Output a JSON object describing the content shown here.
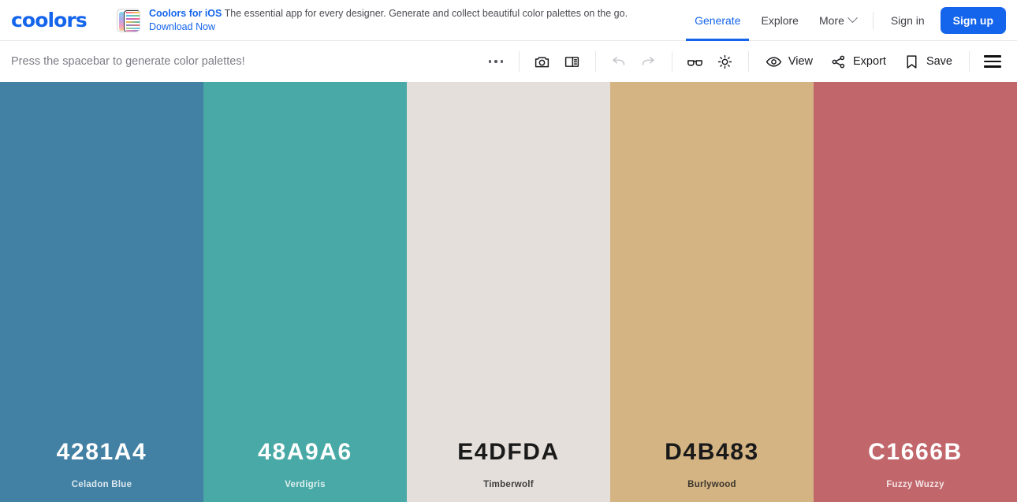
{
  "header": {
    "logo_text": "coolors",
    "promo": {
      "title": "Coolors for iOS",
      "body": "The essential app for every designer. Generate and collect beautiful color palettes on the go.",
      "link": "Download Now",
      "icon": "ios-app-icon"
    },
    "nav": [
      {
        "label": "Generate",
        "active": true
      },
      {
        "label": "Explore",
        "active": false
      },
      {
        "label": "More",
        "active": false,
        "caret": "chevron-down-icon"
      }
    ],
    "signin_label": "Sign in",
    "signup_label": "Sign up",
    "accent_color": "#1565EC"
  },
  "toolbar": {
    "hint": "Press the spacebar to generate color palettes!",
    "icon_tools": [
      {
        "name": "more-options-icon",
        "label": ""
      },
      {
        "name": "camera-icon",
        "label": ""
      },
      {
        "name": "layout-panel-icon",
        "label": ""
      },
      {
        "name": "undo-icon",
        "label": "",
        "disabled": true
      },
      {
        "name": "redo-icon",
        "label": "",
        "disabled": true
      },
      {
        "name": "colorblind-glasses-icon",
        "label": ""
      },
      {
        "name": "adjust-brightness-icon",
        "label": ""
      }
    ],
    "view_label": "View",
    "export_label": "Export",
    "save_label": "Save",
    "menu_icon": "hamburger-menu-icon"
  },
  "palette": [
    {
      "hex": "4281A4",
      "color": "#4281A4",
      "name": "Celadon Blue",
      "text_color": "#FFFFFF"
    },
    {
      "hex": "48A9A6",
      "color": "#48A9A6",
      "name": "Verdigris",
      "text_color": "#FFFFFF"
    },
    {
      "hex": "E4DFDA",
      "color": "#E4DFDA",
      "name": "Timberwolf",
      "text_color": "#1A1A1A"
    },
    {
      "hex": "D4B483",
      "color": "#D4B483",
      "name": "Burlywood",
      "text_color": "#1A1A1A"
    },
    {
      "hex": "C1666B",
      "color": "#C1666B",
      "name": "Fuzzy Wuzzy",
      "text_color": "#FFFFFF"
    }
  ]
}
